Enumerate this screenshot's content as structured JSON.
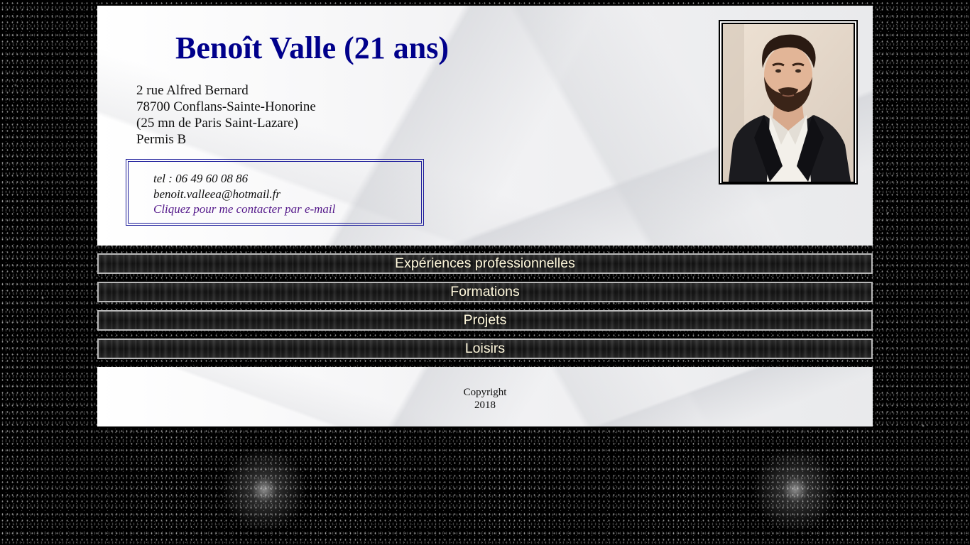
{
  "header": {
    "name_title": "Benoît Valle (21 ans)",
    "address_lines": [
      "2 rue Alfred Bernard",
      "78700 Conflans-Sainte-Honorine",
      "(25 mn de Paris Saint-Lazare)",
      "Permis B"
    ],
    "contact": {
      "phone": "tel : 06 49 60 08 86",
      "email": "benoit.valleea@hotmail.fr",
      "link_label": "Cliquez pour me contacter par e-mail"
    }
  },
  "nav": [
    {
      "label": "Expériences professionnelles"
    },
    {
      "label": "Formations"
    },
    {
      "label": "Projets"
    },
    {
      "label": "Loisirs"
    }
  ],
  "footer": {
    "copyright_label": "Copyright",
    "year": "2018"
  },
  "colors": {
    "title": "#00008b",
    "contact_link": "#551a8b",
    "nav_text": "#fff8dc",
    "nav_border": "#b8b8b8"
  },
  "icons": {
    "profile_photo": "person-portrait"
  }
}
